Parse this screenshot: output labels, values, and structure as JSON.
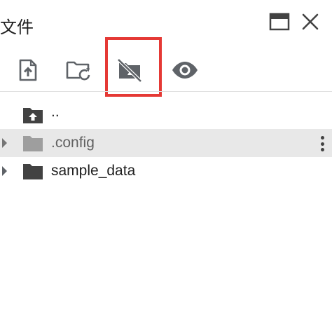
{
  "panel": {
    "title": "文件"
  },
  "window_controls": {
    "maximize_icon": "maximize-window-icon",
    "close_icon": "close-icon"
  },
  "toolbar": {
    "buttons": [
      {
        "icon": "upload-file-icon"
      },
      {
        "icon": "folder-refresh-icon"
      },
      {
        "icon": "drive-unmount-icon",
        "highlighted": true
      },
      {
        "icon": "eye-icon"
      }
    ],
    "highlight_color": "#e53935"
  },
  "file_tree": {
    "items": [
      {
        "name": "..",
        "icon": "folder-up-icon",
        "expandable": false
      },
      {
        "name": ".config",
        "icon": "folder-icon",
        "expandable": true,
        "selected": true,
        "dimmed": true
      },
      {
        "name": "sample_data",
        "icon": "folder-icon",
        "expandable": true
      }
    ]
  },
  "colors": {
    "icon": "#5f6368",
    "selected_row": "#e8e8e8",
    "divider": "#e0e0e0"
  }
}
